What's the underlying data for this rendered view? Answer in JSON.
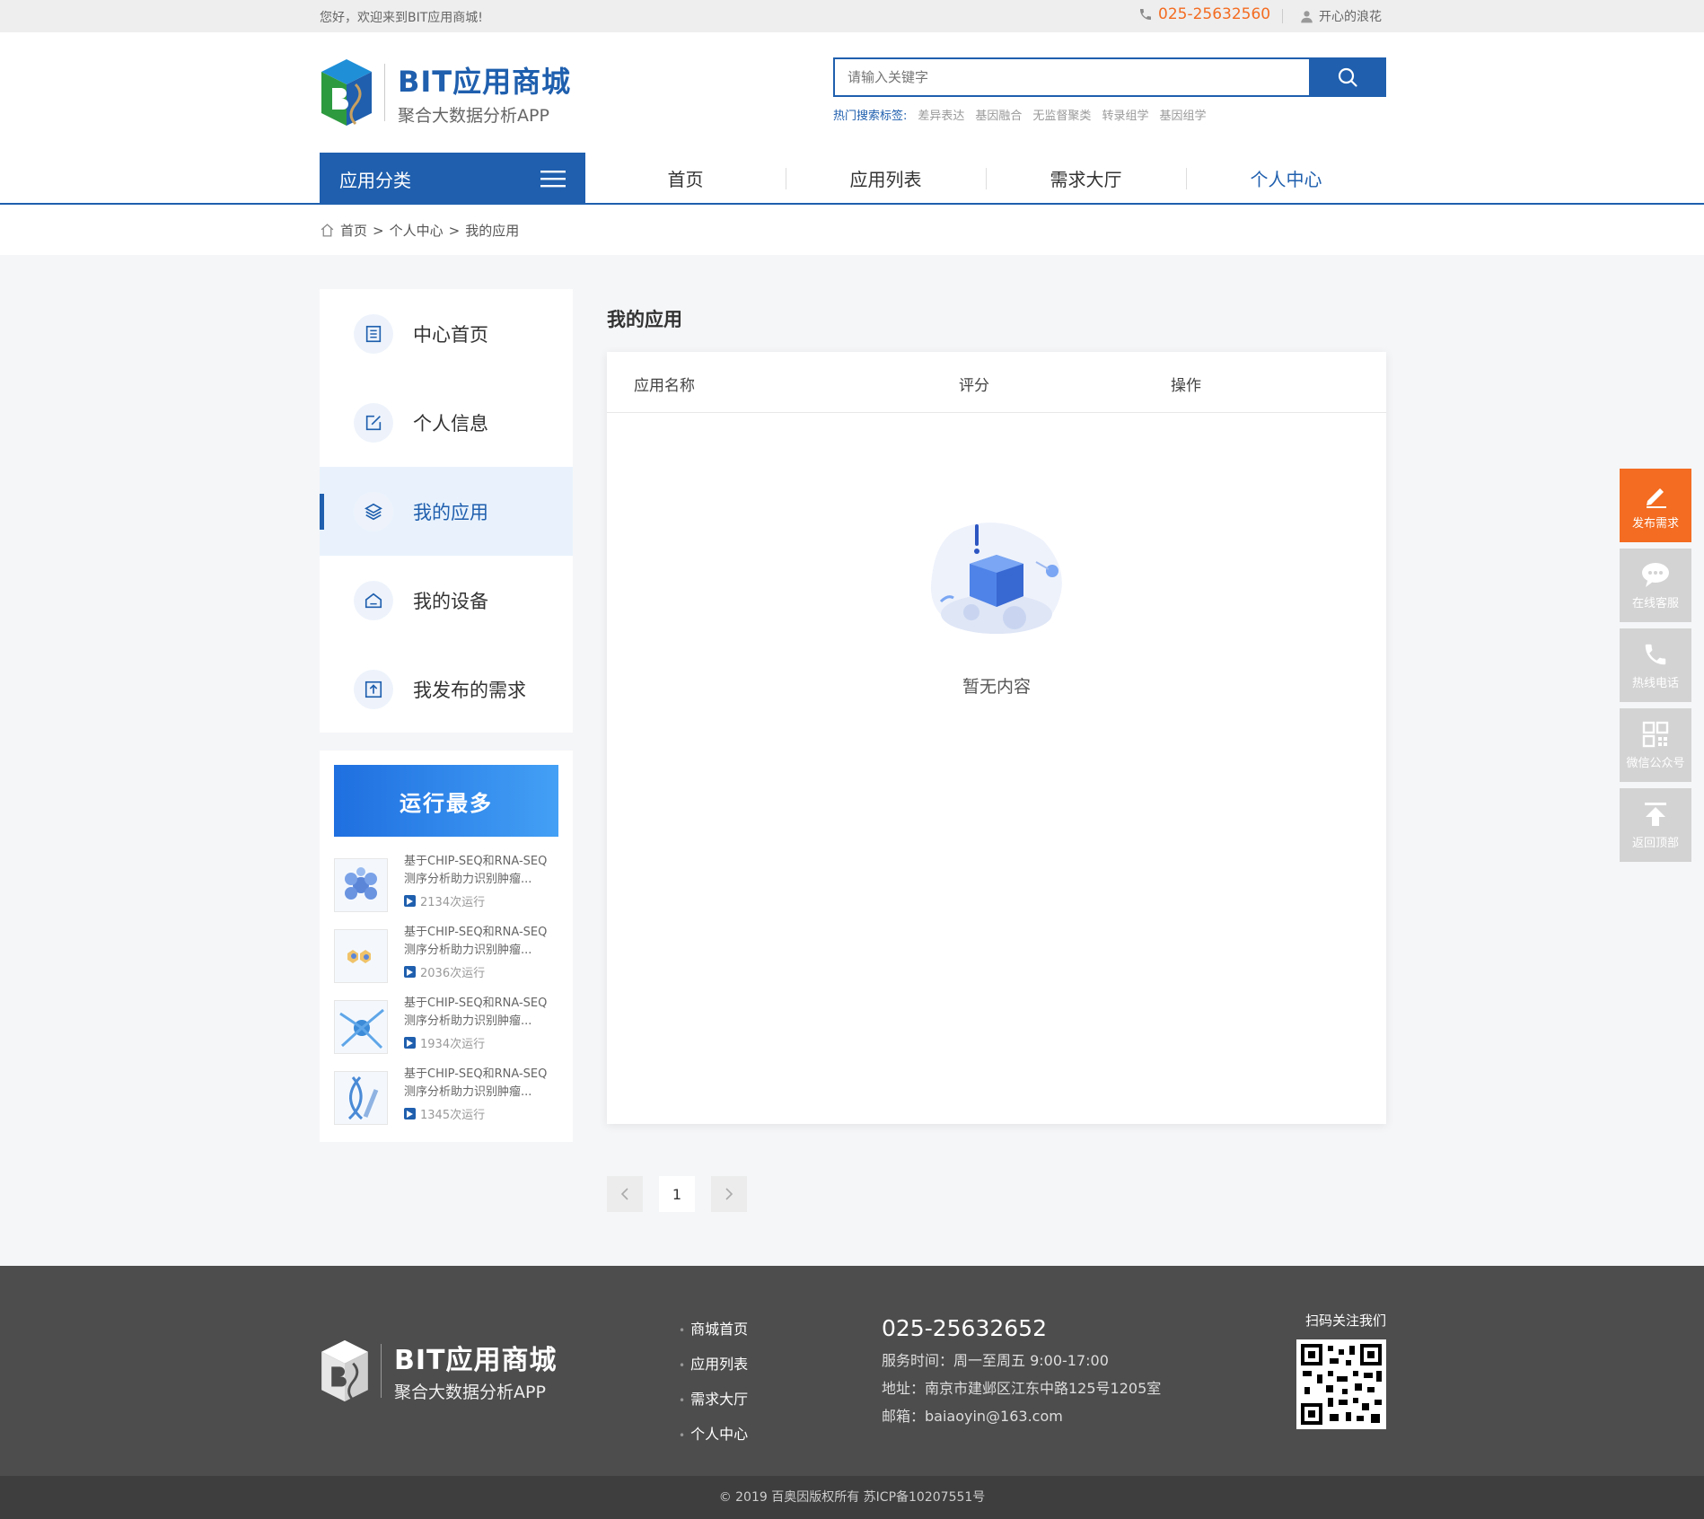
{
  "topbar": {
    "welcome": "您好，欢迎来到BIT应用商城!",
    "phone": "025-25632560",
    "username": "开心的浪花"
  },
  "brand": {
    "name": "BIT应用商城",
    "tagline": "聚合大数据分析APP"
  },
  "search": {
    "placeholder": "请输入关键字",
    "hot_label": "热门搜索标签:",
    "hot_tags": [
      "差异表达",
      "基因融合",
      "无监督聚类",
      "转录组学",
      "基因组学"
    ]
  },
  "nav": {
    "category_label": "应用分类",
    "items": [
      "首页",
      "应用列表",
      "需求大厅",
      "个人中心"
    ],
    "active_index": 3
  },
  "breadcrumb": [
    "首页",
    "个人中心",
    "我的应用"
  ],
  "sidebar": {
    "items": [
      "中心首页",
      "个人信息",
      "我的应用",
      "我的设备",
      "我发布的需求"
    ],
    "active_index": 2
  },
  "most_run": {
    "title": "运行最多",
    "items": [
      {
        "title": "基于CHIP-SEQ和RNA-SEQ测序分析助力识别肿瘤...",
        "count": "2134次运行"
      },
      {
        "title": "基于CHIP-SEQ和RNA-SEQ测序分析助力识别肿瘤...",
        "count": "2036次运行"
      },
      {
        "title": "基于CHIP-SEQ和RNA-SEQ测序分析助力识别肿瘤...",
        "count": "1934次运行"
      },
      {
        "title": "基于CHIP-SEQ和RNA-SEQ测序分析助力识别肿瘤...",
        "count": "1345次运行"
      }
    ]
  },
  "main": {
    "title": "我的应用",
    "columns": [
      "应用名称",
      "评分",
      "操作"
    ],
    "empty_text": "暂无内容"
  },
  "pager": {
    "current": "1"
  },
  "float": [
    "发布需求",
    "在线客服",
    "热线电话",
    "微信公众号",
    "返回顶部"
  ],
  "footer": {
    "brand": "BIT应用商城",
    "tagline": "聚合大数据分析APP",
    "links": [
      "商城首页",
      "应用列表",
      "需求大厅",
      "个人中心"
    ],
    "phone": "025-25632652",
    "hours": "服务时间：周一至周五 9:00-17:00",
    "address": "地址：南京市建邺区江东中路125号1205室",
    "email": "邮箱：baiaoyin@163.com",
    "qr_label": "扫码关注我们",
    "copyright": "© 2019 百奥因版权所有   苏ICP备10207551号"
  },
  "colors": {
    "primary": "#1f5fae",
    "accent": "#f36c21",
    "footer_bg": "#4d4d4d"
  }
}
